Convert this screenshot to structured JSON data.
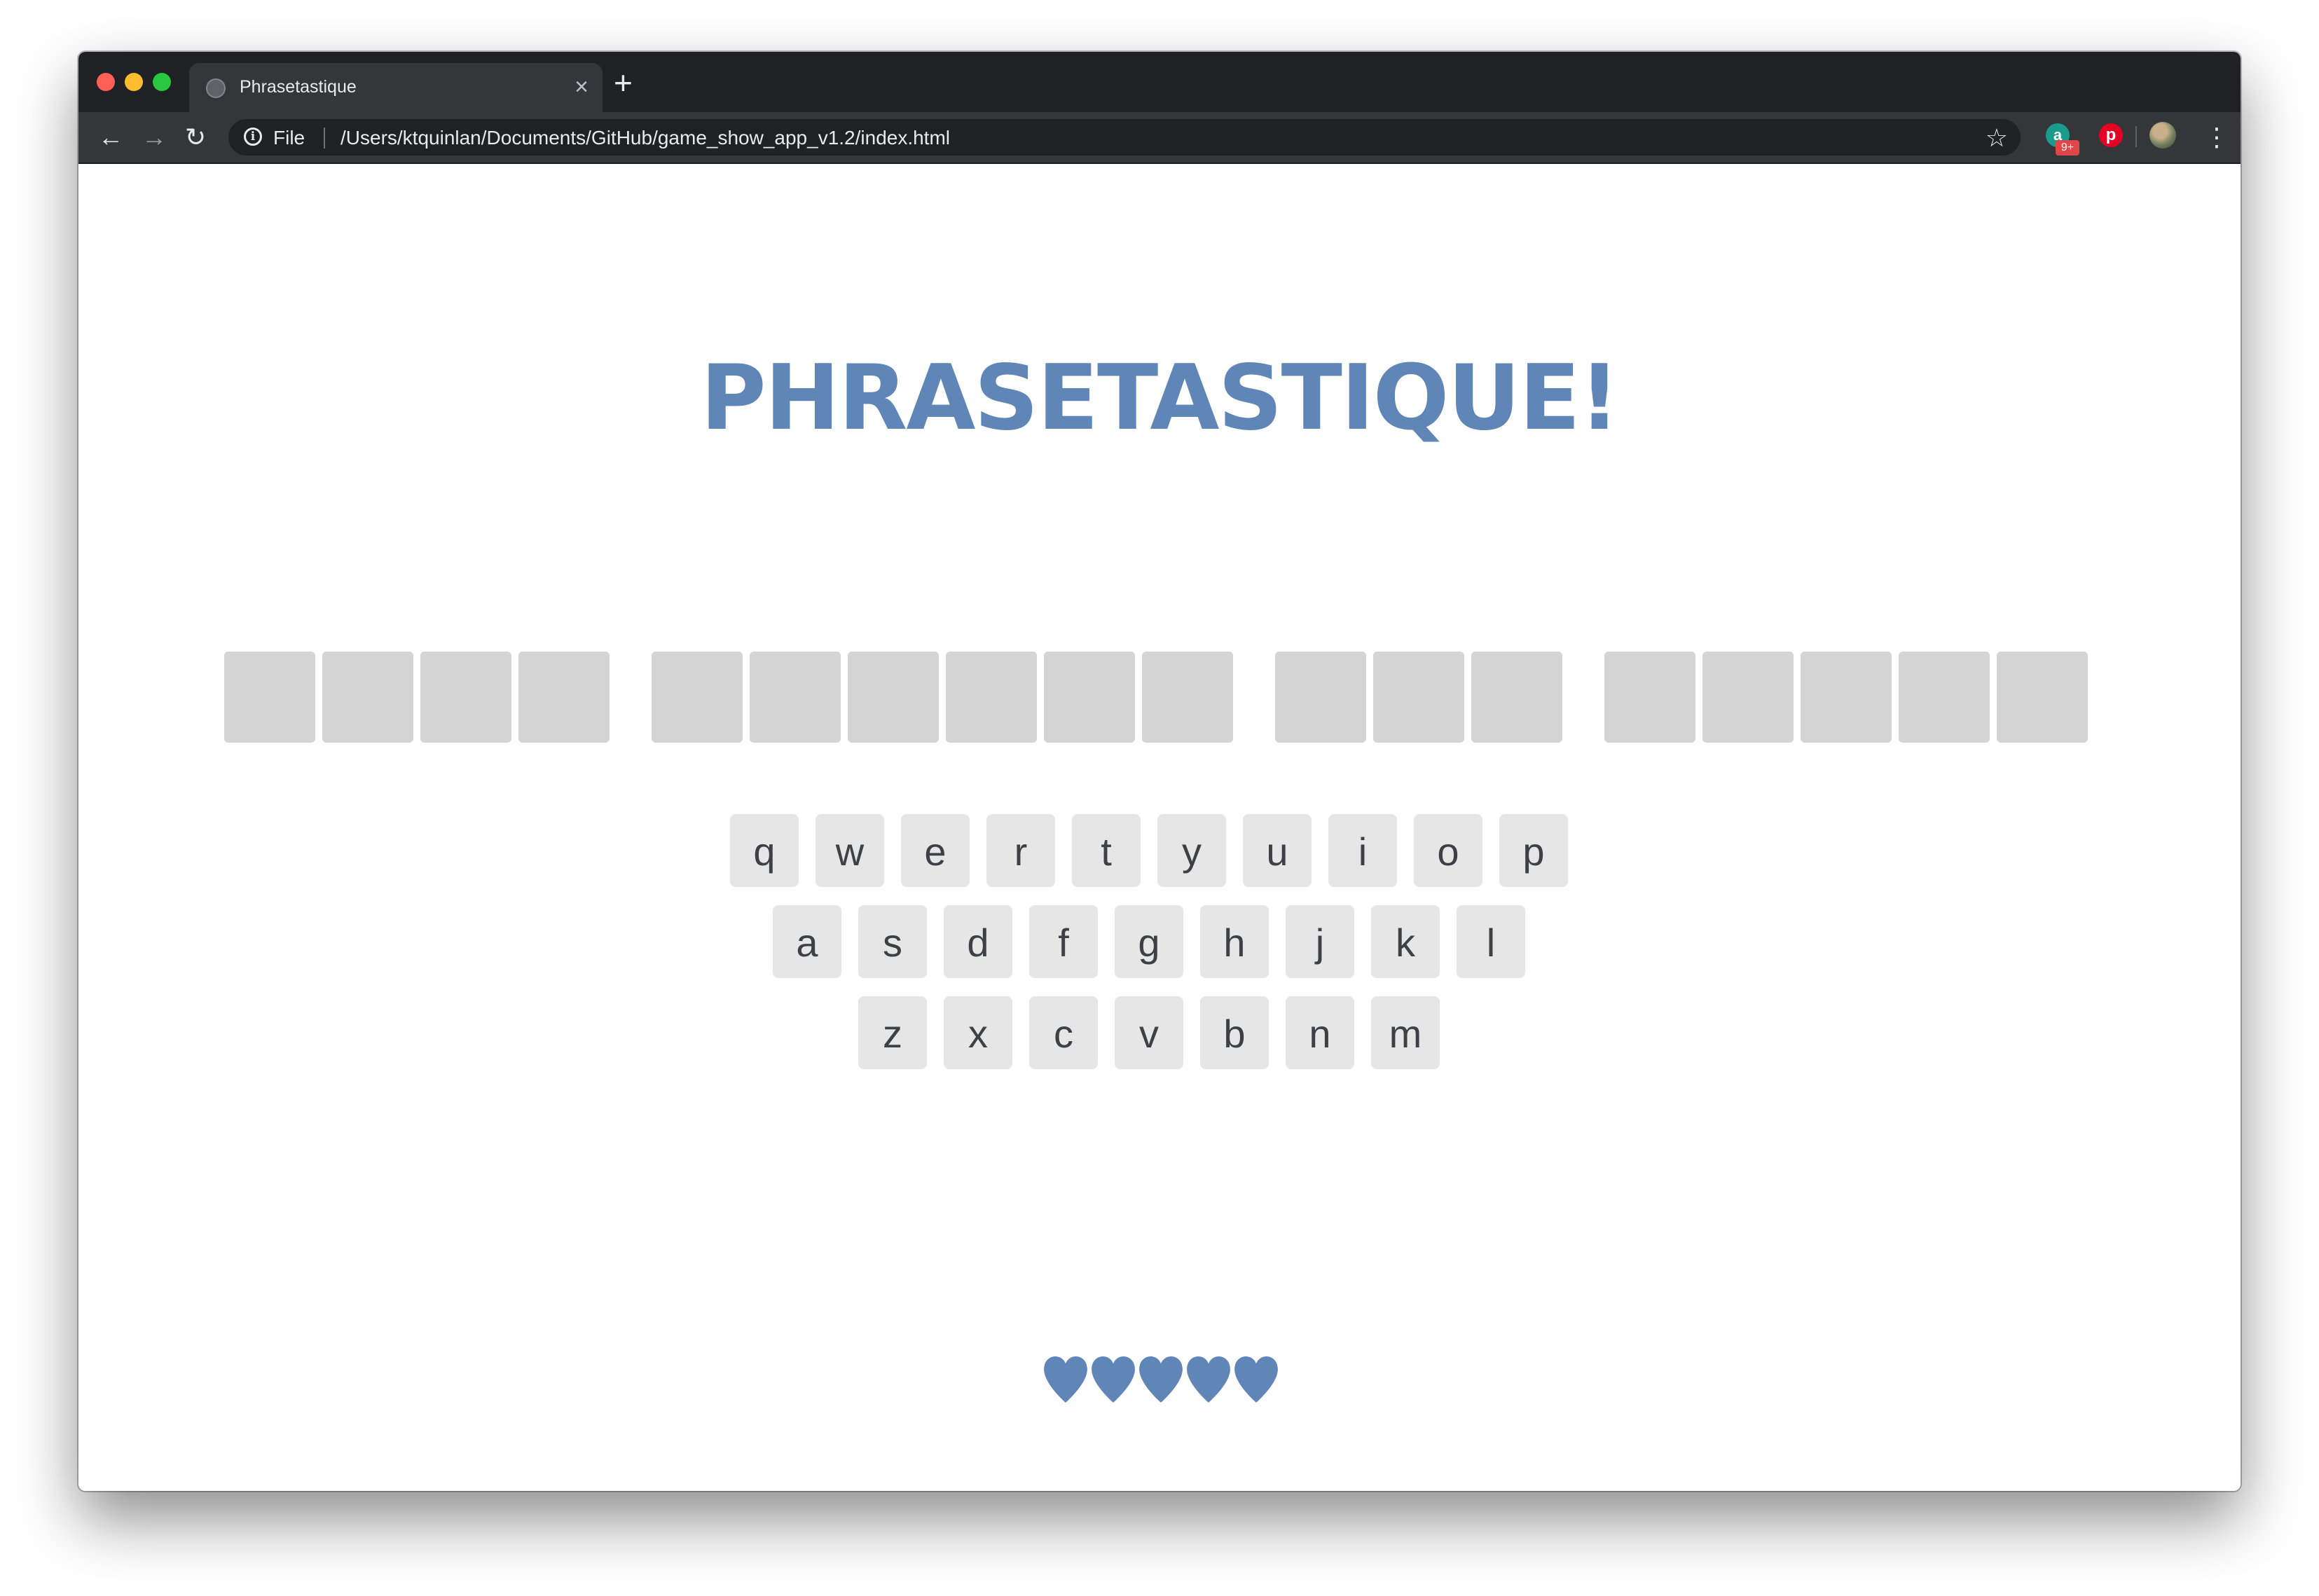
{
  "browser": {
    "tab_title": "Phrasetastique",
    "tab_close": "×",
    "new_tab": "+",
    "back": "←",
    "forward": "→",
    "reload": "↻",
    "info": "i",
    "scheme": "File",
    "url": "/Users/ktquinlan/Documents/GitHub/game_show_app_v1.2/index.html",
    "bookmark": "☆",
    "extension_badge": "9+",
    "extension_a_letter": "a",
    "extension_p_letter": "p",
    "menu": "⋮",
    "icons": [
      "back-arrow-icon",
      "forward-arrow-icon",
      "reload-icon",
      "info-icon",
      "star-icon",
      "grammarly-extension-icon",
      "pinterest-extension-icon",
      "profile-avatar",
      "kebab-menu-icon"
    ]
  },
  "game": {
    "title": "PHRASETASTIQUE!",
    "phrase_words": [
      4,
      6,
      3,
      5
    ],
    "keyboard_rows": [
      [
        "q",
        "w",
        "e",
        "r",
        "t",
        "y",
        "u",
        "i",
        "o",
        "p"
      ],
      [
        "a",
        "s",
        "d",
        "f",
        "g",
        "h",
        "j",
        "k",
        "l"
      ],
      [
        "z",
        "x",
        "c",
        "v",
        "b",
        "n",
        "m"
      ]
    ],
    "lives": 5,
    "colors": {
      "accent": "#5f86b7",
      "tile": "#d4d4d4",
      "key": "#e6e6e6",
      "key_text": "#3d4044"
    }
  }
}
